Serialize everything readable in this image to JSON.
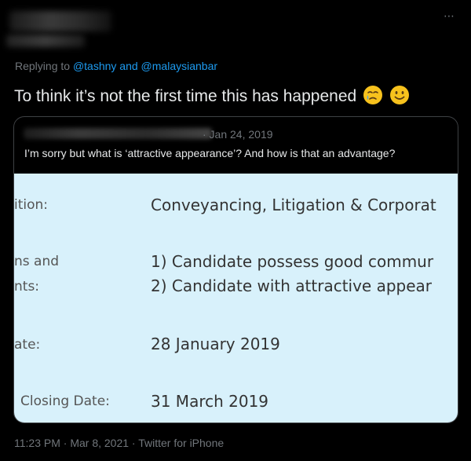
{
  "tweet": {
    "reply_prefix": "Replying to",
    "reply_user1": "@tashny",
    "reply_and": "and",
    "reply_user2": "@malaysianbar",
    "text": "To think it’s not the first time this has happened",
    "emojis": [
      "crying-face-emoji",
      "smiling-face-emoji"
    ],
    "more_icon": "⋯",
    "timestamp": "11:23 PM · Mar 8, 2021 · Twitter for iPhone"
  },
  "quote": {
    "date": "· Jan 24, 2019",
    "text": "I’m sorry but what is ‘attractive appearance’? And how is that an advantage?"
  },
  "document": {
    "rows": [
      {
        "label": "ition:",
        "value": "Conveyancing, Litigation & Corporat"
      },
      {
        "label": "ns and",
        "value": "1) Candidate possess good commur"
      },
      {
        "label": "nts:",
        "value": "2) Candidate with attractive appear"
      },
      {
        "label": "ate:",
        "value": "28 January 2019"
      },
      {
        "label": "Closing Date:",
        "value": "31 March 2019"
      }
    ]
  },
  "colors": {
    "background": "#000000",
    "link": "#1d9bf0",
    "muted": "#71767b",
    "doc_bg": "#d8f1fb"
  }
}
